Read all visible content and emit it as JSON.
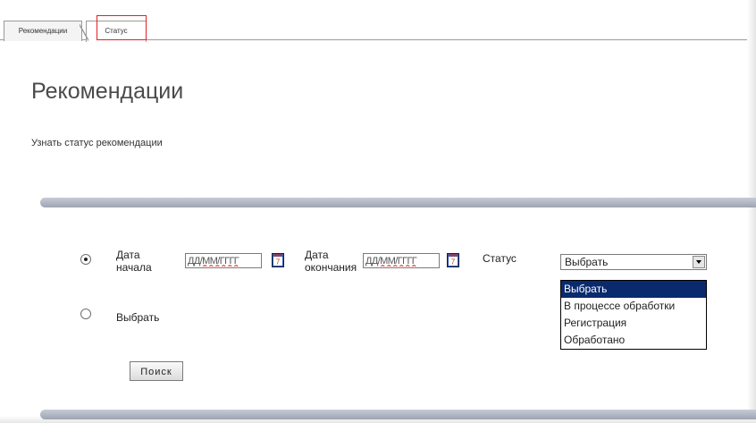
{
  "tabs": [
    {
      "label": "Рекомендации"
    },
    {
      "label": "Статус"
    }
  ],
  "page": {
    "title": "Рекомендации",
    "subtitle": "Узнать статус рекомендации"
  },
  "form": {
    "start_date_label": "Дата\nначала",
    "end_date_label": "Дата\nокончания",
    "date_placeholder": "ДД/ММ/ГГГГ",
    "status_label": "Статус",
    "choose_label": "Выбрать",
    "status_selected": "Выбрать",
    "status_options": [
      "Выбрать",
      "В процессе обработки",
      "Регистрация",
      "Обработано"
    ],
    "search_button": "Поиск"
  },
  "colors": {
    "highlight": "#e02020",
    "selected_option": "#0a2a6e"
  }
}
